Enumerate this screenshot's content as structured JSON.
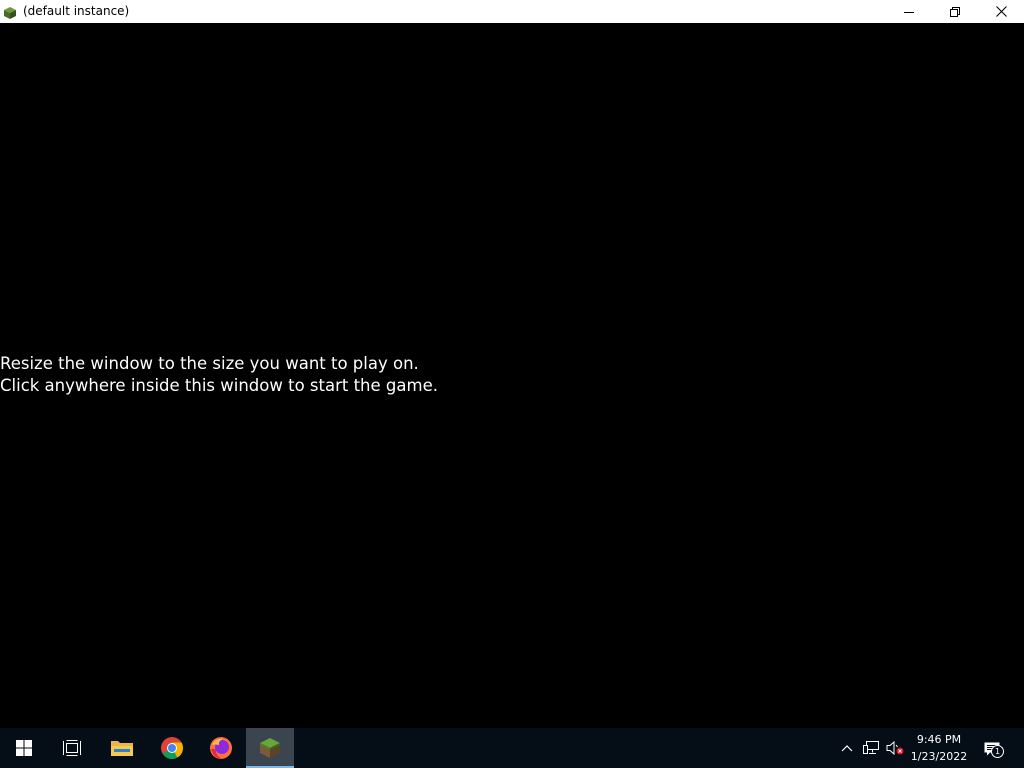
{
  "window": {
    "title": "(default instance)",
    "controls": [
      "minimize-icon",
      "restore-icon",
      "close-icon"
    ]
  },
  "game": {
    "line1": "Resize the window to the size you want to play on.",
    "line2": "Click anywhere inside this window to start the game.",
    "text_color": "#ffffff",
    "background": "#000000"
  },
  "taskbar": {
    "apps": [
      {
        "name": "start-button",
        "icon": "windows-logo-icon"
      },
      {
        "name": "task-view-button",
        "icon": "task-view-icon"
      },
      {
        "name": "file-explorer-button",
        "icon": "folder-icon"
      },
      {
        "name": "chrome-button",
        "icon": "chrome-icon"
      },
      {
        "name": "firefox-button",
        "icon": "firefox-icon"
      },
      {
        "name": "minecraft-button",
        "icon": "grass-block-icon",
        "active": true
      }
    ],
    "tray_icons": [
      "chevron-up-icon",
      "network-icon",
      "volume-muted-icon"
    ],
    "time": "9:46 PM",
    "date": "1/23/2022",
    "notification_count": "1",
    "accent": "#76b9ed"
  }
}
